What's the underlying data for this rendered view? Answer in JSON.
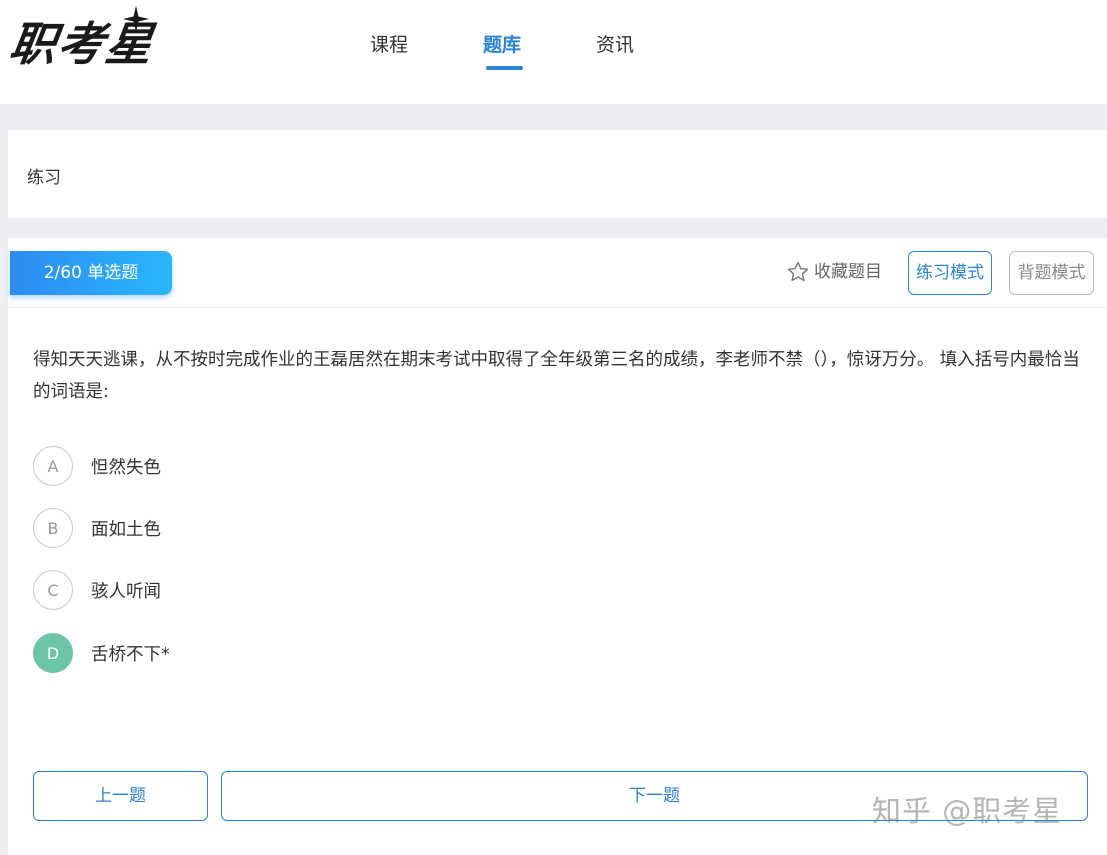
{
  "header": {
    "logo_text": "职考星",
    "nav": [
      {
        "label": "课程",
        "active": false
      },
      {
        "label": "题库",
        "active": true
      },
      {
        "label": "资讯",
        "active": false
      }
    ]
  },
  "breadcrumb": {
    "label": "练习"
  },
  "question": {
    "badge": "2/60 单选题",
    "favorite_label": "收藏题目",
    "mode_practice": "练习模式",
    "mode_recite": "背题模式",
    "stem": "得知天天逃课，从不按时完成作业的王磊居然在期末考试中取得了全年级第三名的成绩，李老师不禁（），惊讶万分。 填入括号内最恰当的词语是:",
    "options": [
      {
        "letter": "A",
        "text": "怛然失色"
      },
      {
        "letter": "B",
        "text": "面如土色"
      },
      {
        "letter": "C",
        "text": "骇人听闻"
      },
      {
        "letter": "D",
        "text": "舌桥不下*",
        "correct": true
      }
    ],
    "prev_label": "上一题",
    "next_label": "下一题"
  },
  "watermark": "知乎 @职考星",
  "colors": {
    "accent": "#2a83d8",
    "correct": "#6cc6a5"
  }
}
